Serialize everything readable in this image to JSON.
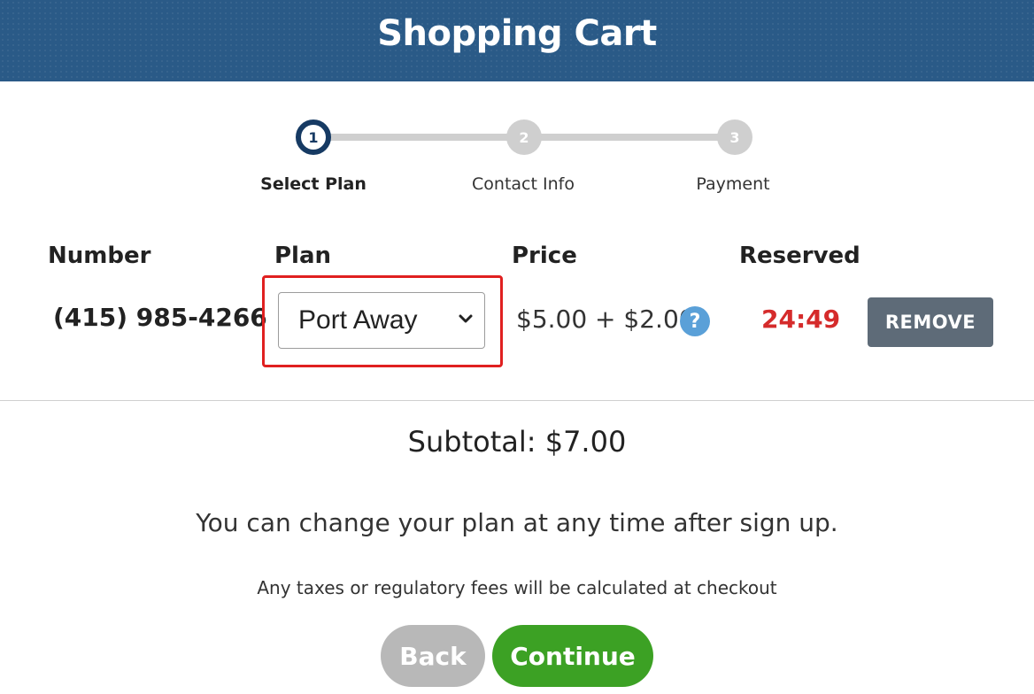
{
  "header": {
    "title": "Shopping Cart"
  },
  "stepper": {
    "steps": [
      {
        "number": "1",
        "label": "Select Plan",
        "state": "active"
      },
      {
        "number": "2",
        "label": "Contact Info",
        "state": "inactive"
      },
      {
        "number": "3",
        "label": "Payment",
        "state": "inactive"
      }
    ]
  },
  "table": {
    "headers": {
      "number": "Number",
      "plan": "Plan",
      "price": "Price",
      "reserved": "Reserved"
    },
    "row": {
      "number": "(415) 985-4266",
      "plan": "Port Away",
      "price": "$5.00 + $2.00",
      "help_icon": "?",
      "reserved": "24:49",
      "remove_label": "REMOVE"
    }
  },
  "summary": {
    "subtotal": "Subtotal: $7.00",
    "note": "You can change your plan at any time after sign up.",
    "fine_print": "Any taxes or regulatory fees will be calculated at checkout"
  },
  "actions": {
    "back_label": "Back",
    "continue_label": "Continue"
  },
  "colors": {
    "header": "#2a5a87",
    "step_active": "#163a63",
    "timer": "#d52b2b",
    "highlight": "#e02020",
    "continue": "#3ca124",
    "back": "#b8b8b8",
    "remove": "#5e6b78",
    "help": "#5aa0d8"
  },
  "icons": {
    "select_arrow": "chevron-down-icon",
    "help": "question-circle-icon"
  }
}
